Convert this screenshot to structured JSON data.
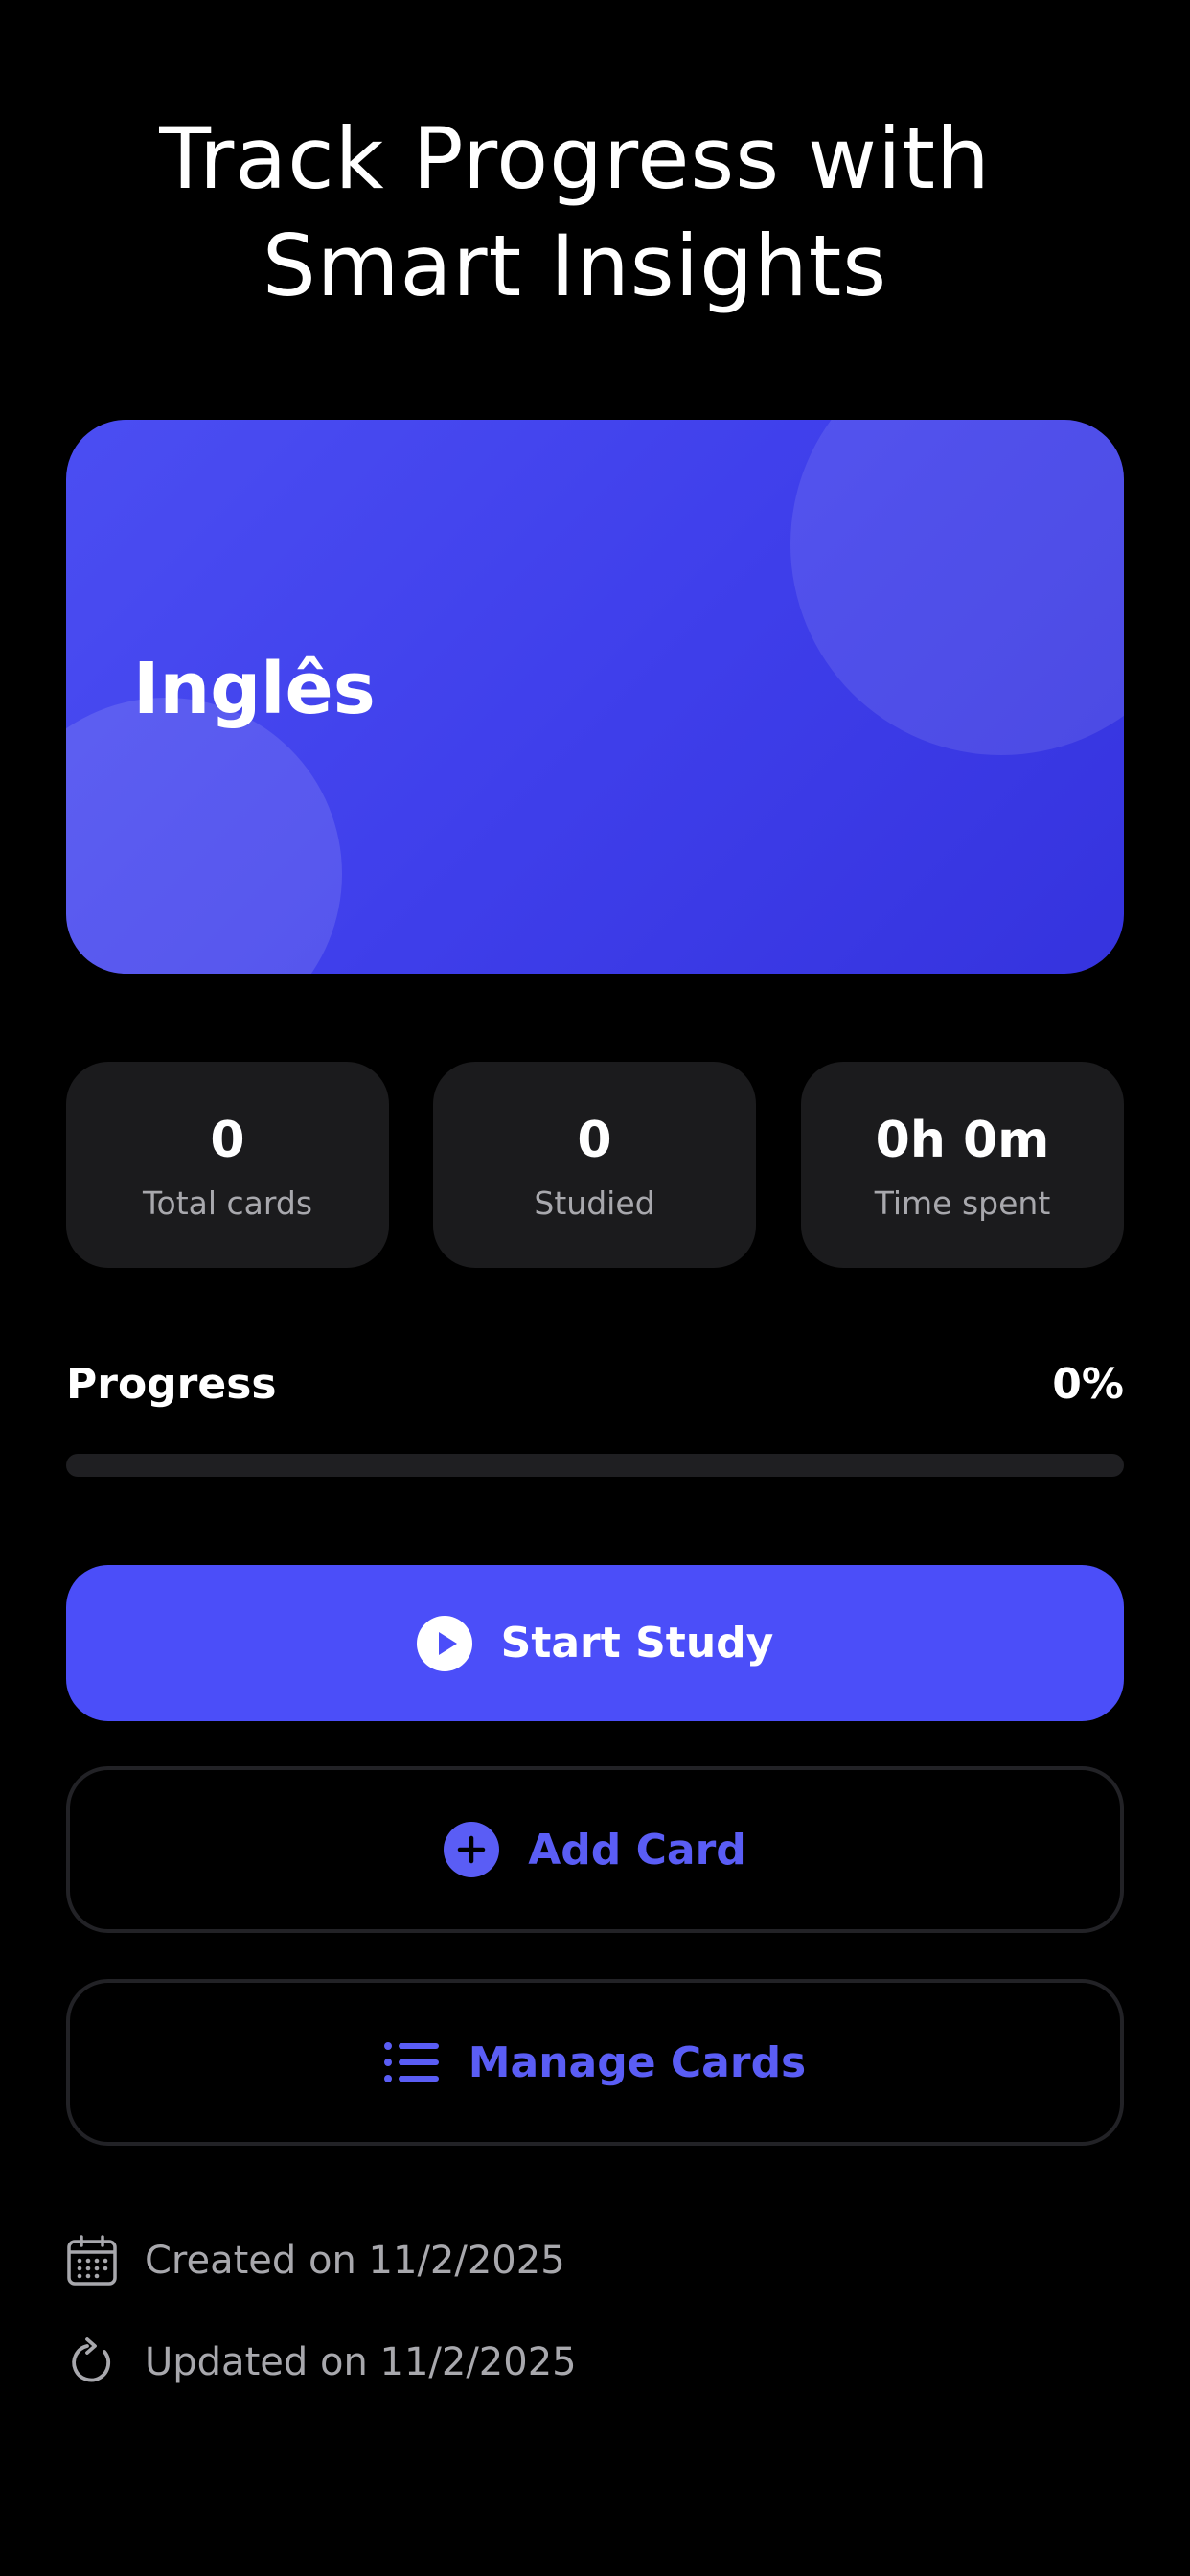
{
  "header": {
    "title_line1": "Track Progress with",
    "title_line2": "Smart Insights"
  },
  "deck": {
    "name": "Inglês",
    "accent_color": "#4b4ef2"
  },
  "stats": [
    {
      "value": "0",
      "label": "Total cards"
    },
    {
      "value": "0",
      "label": "Studied"
    },
    {
      "value": "0h 0m",
      "label": "Time spent"
    }
  ],
  "progress": {
    "label": "Progress",
    "value_text": "0%",
    "fraction": 0
  },
  "actions": {
    "start_study": {
      "label": "Start Study",
      "icon": "play-circle-icon"
    },
    "add_card": {
      "label": "Add Card",
      "icon": "plus-circle-icon"
    },
    "manage_cards": {
      "label": "Manage Cards",
      "icon": "list-icon"
    }
  },
  "meta": {
    "created": {
      "text": "Created on 11/2/2025",
      "icon": "calendar-icon"
    },
    "updated": {
      "text": "Updated on 11/2/2025",
      "icon": "refresh-icon"
    }
  },
  "colors": {
    "background": "#000000",
    "primary": "#4b4ef9",
    "surface": "#1b1b1d",
    "muted_text": "#a8a8ad"
  }
}
